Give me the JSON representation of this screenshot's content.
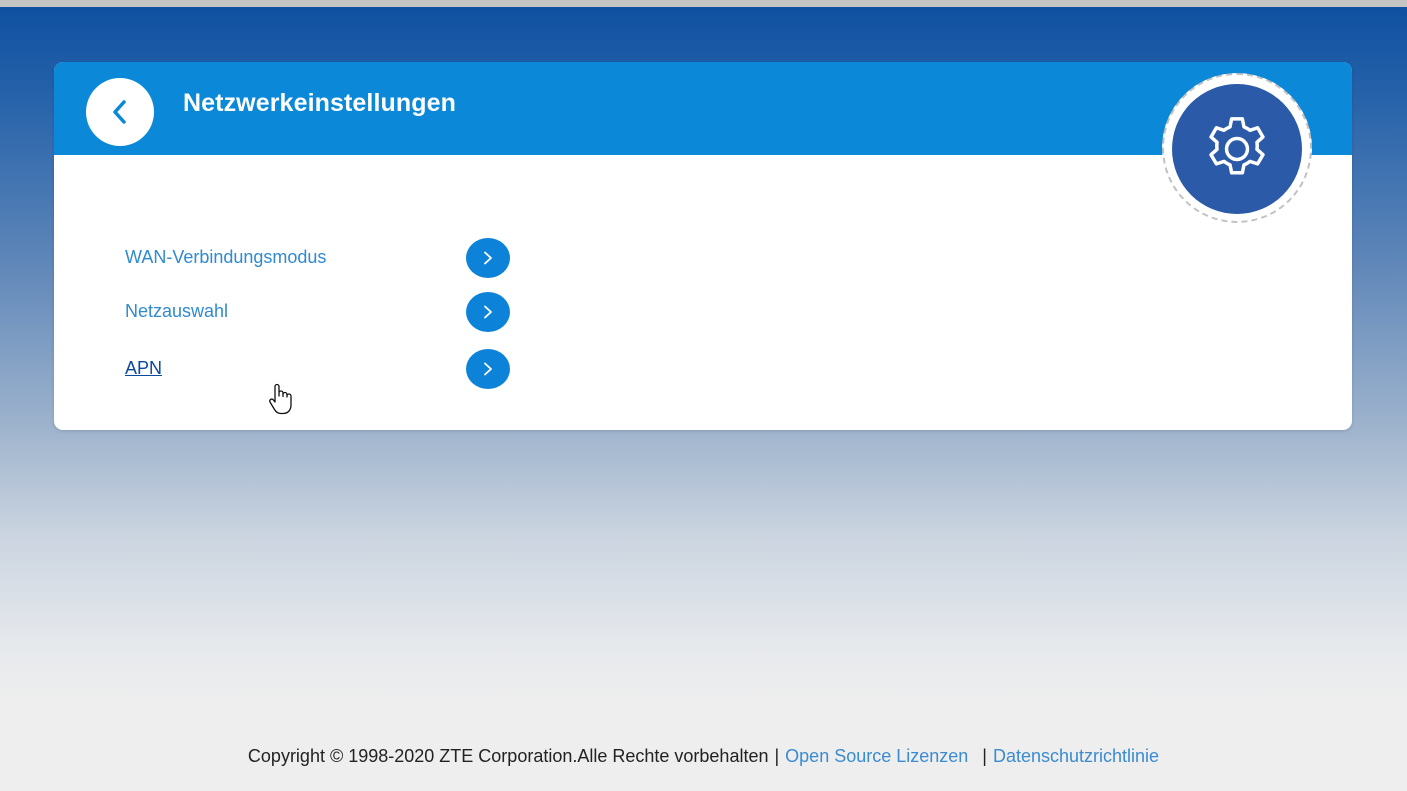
{
  "page": {
    "title": "Netzwerkeinstellungen"
  },
  "menu": {
    "items": [
      {
        "label": "WAN-Verbindungsmodus",
        "active": false
      },
      {
        "label": "Netzauswahl",
        "active": false
      },
      {
        "label": "APN",
        "active": true
      }
    ]
  },
  "footer": {
    "copyright": "Copyright © 1998-2020 ZTE Corporation.Alle Rechte vorbehalten",
    "separator": "|",
    "open_source_link": "Open Source Lizenzen",
    "privacy_link": "Datenschutzrichtlinie"
  },
  "icons": {
    "back": "chevron-left-icon",
    "badge": "gear-icon",
    "item_arrow": "chevron-right-icon",
    "cursor": "hand-pointer-icon"
  },
  "colors": {
    "header_blue": "#0b88d8",
    "badge_blue": "#2b5aa8",
    "link_blue": "#2f8ad0",
    "active_link": "#0a4a9e",
    "arrow_blue": "#0c83d9"
  }
}
